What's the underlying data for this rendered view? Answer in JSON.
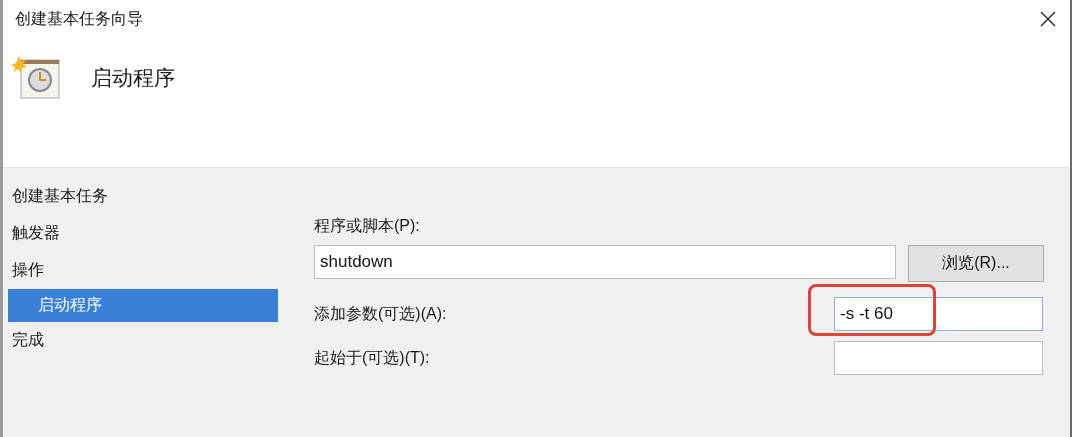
{
  "window": {
    "title": "创建基本任务向导"
  },
  "header": {
    "title": "启动程序"
  },
  "steps": [
    {
      "label": "创建基本任务",
      "kind": "step",
      "selected": false
    },
    {
      "label": "触发器",
      "kind": "step",
      "selected": false
    },
    {
      "label": "操作",
      "kind": "step",
      "selected": false
    },
    {
      "label": "启动程序",
      "kind": "substep",
      "selected": true
    },
    {
      "label": "完成",
      "kind": "step",
      "selected": false
    }
  ],
  "form": {
    "program": {
      "label": "程序或脚本(P):",
      "value": "shutdown",
      "button": "浏览(R)..."
    },
    "arguments": {
      "label": "添加参数(可选)(A):",
      "value": "-s -t 60",
      "focused": true,
      "highlighted": true
    },
    "start_in": {
      "label": "起始于(可选)(T):",
      "focused": false
    }
  }
}
